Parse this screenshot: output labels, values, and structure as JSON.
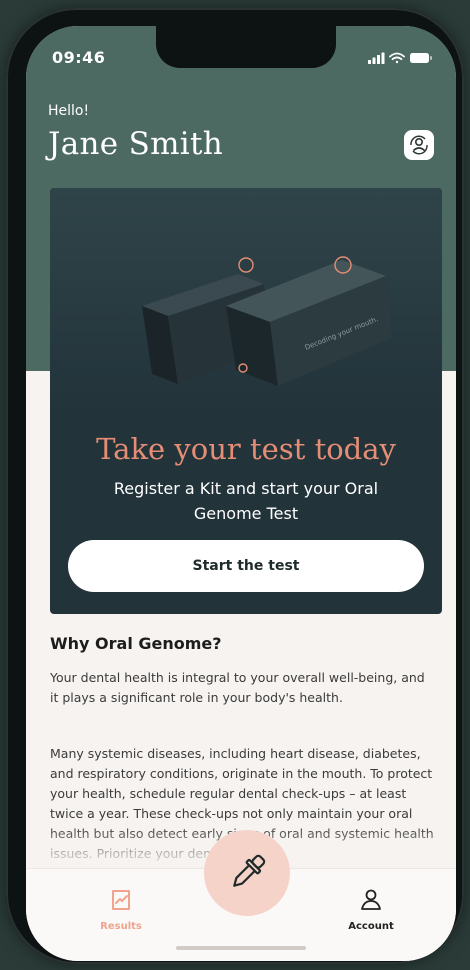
{
  "status": {
    "time": "09:46",
    "icons": [
      "signal-icon",
      "wifi-icon",
      "battery-icon"
    ]
  },
  "header": {
    "greeting": "Hello!",
    "name": "Jane Smith",
    "profile_icon": "profile-switch-icon"
  },
  "promo": {
    "title": "Take your test today",
    "subtitle": "Register a Kit and start your Oral Genome Test",
    "button_label": "Start the test"
  },
  "about": {
    "title": "Why Oral Genome?",
    "paragraph1": "Your dental health is integral to your overall well-being, and it plays a significant role in your body's health.",
    "paragraph2": "Many systemic diseases, including heart disease, diabetes, and respiratory conditions, originate in the mouth. To protect your health, schedule regular dental check-ups – at least twice a year. These check-ups not only maintain your oral health but also detect early signs of oral and systemic health issues. Prioritize your dental"
  },
  "tabs": {
    "results": "Results",
    "account": "Account"
  },
  "colors": {
    "header_bg": "#4c6962",
    "card_bg": "#22333a",
    "accent": "#e58d75",
    "fab_bg": "#f6d3c8"
  }
}
